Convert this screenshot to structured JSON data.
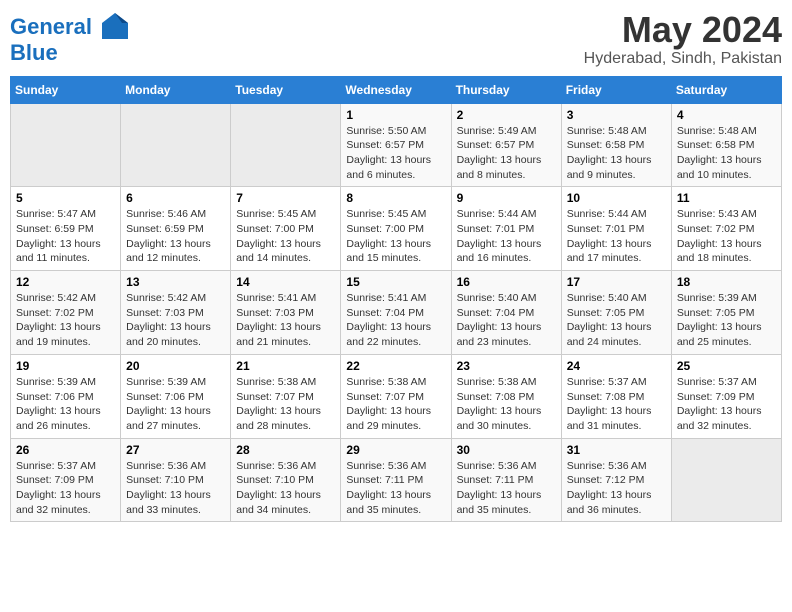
{
  "header": {
    "logo_line1": "General",
    "logo_line2": "Blue",
    "month_year": "May 2024",
    "location": "Hyderabad, Sindh, Pakistan"
  },
  "days_of_week": [
    "Sunday",
    "Monday",
    "Tuesday",
    "Wednesday",
    "Thursday",
    "Friday",
    "Saturday"
  ],
  "weeks": [
    [
      {
        "day": "",
        "sunrise": "",
        "sunset": "",
        "daylight": ""
      },
      {
        "day": "",
        "sunrise": "",
        "sunset": "",
        "daylight": ""
      },
      {
        "day": "",
        "sunrise": "",
        "sunset": "",
        "daylight": ""
      },
      {
        "day": "1",
        "sunrise": "Sunrise: 5:50 AM",
        "sunset": "Sunset: 6:57 PM",
        "daylight": "Daylight: 13 hours and 6 minutes."
      },
      {
        "day": "2",
        "sunrise": "Sunrise: 5:49 AM",
        "sunset": "Sunset: 6:57 PM",
        "daylight": "Daylight: 13 hours and 8 minutes."
      },
      {
        "day": "3",
        "sunrise": "Sunrise: 5:48 AM",
        "sunset": "Sunset: 6:58 PM",
        "daylight": "Daylight: 13 hours and 9 minutes."
      },
      {
        "day": "4",
        "sunrise": "Sunrise: 5:48 AM",
        "sunset": "Sunset: 6:58 PM",
        "daylight": "Daylight: 13 hours and 10 minutes."
      }
    ],
    [
      {
        "day": "5",
        "sunrise": "Sunrise: 5:47 AM",
        "sunset": "Sunset: 6:59 PM",
        "daylight": "Daylight: 13 hours and 11 minutes."
      },
      {
        "day": "6",
        "sunrise": "Sunrise: 5:46 AM",
        "sunset": "Sunset: 6:59 PM",
        "daylight": "Daylight: 13 hours and 12 minutes."
      },
      {
        "day": "7",
        "sunrise": "Sunrise: 5:45 AM",
        "sunset": "Sunset: 7:00 PM",
        "daylight": "Daylight: 13 hours and 14 minutes."
      },
      {
        "day": "8",
        "sunrise": "Sunrise: 5:45 AM",
        "sunset": "Sunset: 7:00 PM",
        "daylight": "Daylight: 13 hours and 15 minutes."
      },
      {
        "day": "9",
        "sunrise": "Sunrise: 5:44 AM",
        "sunset": "Sunset: 7:01 PM",
        "daylight": "Daylight: 13 hours and 16 minutes."
      },
      {
        "day": "10",
        "sunrise": "Sunrise: 5:44 AM",
        "sunset": "Sunset: 7:01 PM",
        "daylight": "Daylight: 13 hours and 17 minutes."
      },
      {
        "day": "11",
        "sunrise": "Sunrise: 5:43 AM",
        "sunset": "Sunset: 7:02 PM",
        "daylight": "Daylight: 13 hours and 18 minutes."
      }
    ],
    [
      {
        "day": "12",
        "sunrise": "Sunrise: 5:42 AM",
        "sunset": "Sunset: 7:02 PM",
        "daylight": "Daylight: 13 hours and 19 minutes."
      },
      {
        "day": "13",
        "sunrise": "Sunrise: 5:42 AM",
        "sunset": "Sunset: 7:03 PM",
        "daylight": "Daylight: 13 hours and 20 minutes."
      },
      {
        "day": "14",
        "sunrise": "Sunrise: 5:41 AM",
        "sunset": "Sunset: 7:03 PM",
        "daylight": "Daylight: 13 hours and 21 minutes."
      },
      {
        "day": "15",
        "sunrise": "Sunrise: 5:41 AM",
        "sunset": "Sunset: 7:04 PM",
        "daylight": "Daylight: 13 hours and 22 minutes."
      },
      {
        "day": "16",
        "sunrise": "Sunrise: 5:40 AM",
        "sunset": "Sunset: 7:04 PM",
        "daylight": "Daylight: 13 hours and 23 minutes."
      },
      {
        "day": "17",
        "sunrise": "Sunrise: 5:40 AM",
        "sunset": "Sunset: 7:05 PM",
        "daylight": "Daylight: 13 hours and 24 minutes."
      },
      {
        "day": "18",
        "sunrise": "Sunrise: 5:39 AM",
        "sunset": "Sunset: 7:05 PM",
        "daylight": "Daylight: 13 hours and 25 minutes."
      }
    ],
    [
      {
        "day": "19",
        "sunrise": "Sunrise: 5:39 AM",
        "sunset": "Sunset: 7:06 PM",
        "daylight": "Daylight: 13 hours and 26 minutes."
      },
      {
        "day": "20",
        "sunrise": "Sunrise: 5:39 AM",
        "sunset": "Sunset: 7:06 PM",
        "daylight": "Daylight: 13 hours and 27 minutes."
      },
      {
        "day": "21",
        "sunrise": "Sunrise: 5:38 AM",
        "sunset": "Sunset: 7:07 PM",
        "daylight": "Daylight: 13 hours and 28 minutes."
      },
      {
        "day": "22",
        "sunrise": "Sunrise: 5:38 AM",
        "sunset": "Sunset: 7:07 PM",
        "daylight": "Daylight: 13 hours and 29 minutes."
      },
      {
        "day": "23",
        "sunrise": "Sunrise: 5:38 AM",
        "sunset": "Sunset: 7:08 PM",
        "daylight": "Daylight: 13 hours and 30 minutes."
      },
      {
        "day": "24",
        "sunrise": "Sunrise: 5:37 AM",
        "sunset": "Sunset: 7:08 PM",
        "daylight": "Daylight: 13 hours and 31 minutes."
      },
      {
        "day": "25",
        "sunrise": "Sunrise: 5:37 AM",
        "sunset": "Sunset: 7:09 PM",
        "daylight": "Daylight: 13 hours and 32 minutes."
      }
    ],
    [
      {
        "day": "26",
        "sunrise": "Sunrise: 5:37 AM",
        "sunset": "Sunset: 7:09 PM",
        "daylight": "Daylight: 13 hours and 32 minutes."
      },
      {
        "day": "27",
        "sunrise": "Sunrise: 5:36 AM",
        "sunset": "Sunset: 7:10 PM",
        "daylight": "Daylight: 13 hours and 33 minutes."
      },
      {
        "day": "28",
        "sunrise": "Sunrise: 5:36 AM",
        "sunset": "Sunset: 7:10 PM",
        "daylight": "Daylight: 13 hours and 34 minutes."
      },
      {
        "day": "29",
        "sunrise": "Sunrise: 5:36 AM",
        "sunset": "Sunset: 7:11 PM",
        "daylight": "Daylight: 13 hours and 35 minutes."
      },
      {
        "day": "30",
        "sunrise": "Sunrise: 5:36 AM",
        "sunset": "Sunset: 7:11 PM",
        "daylight": "Daylight: 13 hours and 35 minutes."
      },
      {
        "day": "31",
        "sunrise": "Sunrise: 5:36 AM",
        "sunset": "Sunset: 7:12 PM",
        "daylight": "Daylight: 13 hours and 36 minutes."
      },
      {
        "day": "",
        "sunrise": "",
        "sunset": "",
        "daylight": ""
      }
    ]
  ]
}
